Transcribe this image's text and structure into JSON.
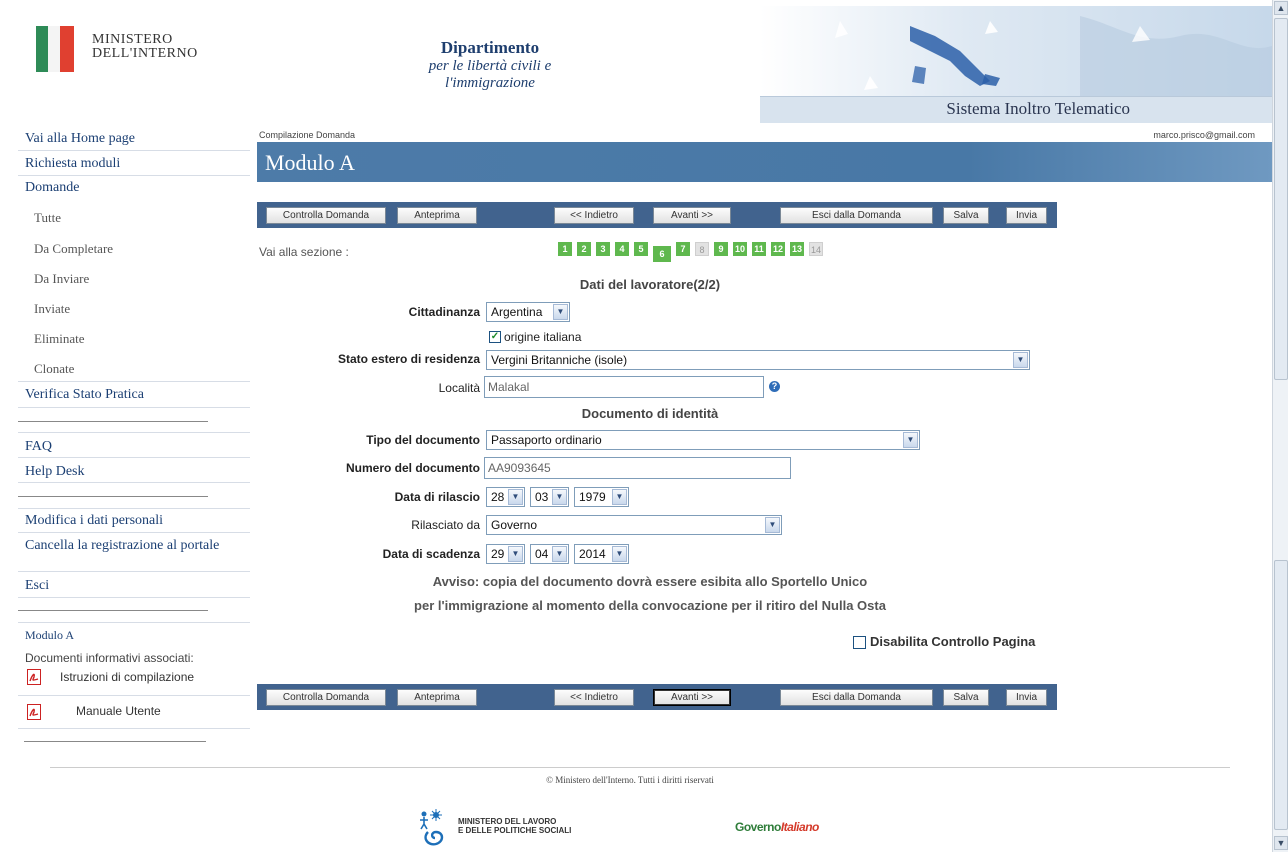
{
  "header": {
    "ministry_line1": "MINISTERO",
    "ministry_line2": "DELL'INTERNO",
    "dept_line1": "Dipartimento",
    "dept_line2": "per le libertà civili e",
    "dept_line3": "l'immigrazione",
    "system_title": "Sistema Inoltro Telematico"
  },
  "nav": {
    "home": "Vai alla Home page",
    "richiesta": "Richiesta moduli",
    "domande": "Domande",
    "tutte": "Tutte",
    "da_completare": "Da Completare",
    "da_inviare": "Da Inviare",
    "inviate": "Inviate",
    "eliminate": "Eliminate",
    "clonate": "Clonate",
    "verifica": "Verifica Stato Pratica",
    "faq": "FAQ",
    "helpdesk": "Help Desk",
    "modifica": "Modifica i dati personali",
    "cancella": "Cancella la registrazione al portale",
    "esci": "Esci",
    "modulo": "Modulo A",
    "documenti": "Documenti informativi associati:",
    "istruzioni": "Istruzioni di compilazione",
    "manuale": "Manuale Utente"
  },
  "main": {
    "breadcrumb": "Compilazione Domanda",
    "user_email": "marco.prisco@gmail.com",
    "title": "Modulo A",
    "vai_sezione": "Vai alla sezione :"
  },
  "toolbar": {
    "controlla": "Controlla Domanda",
    "anteprima": "Anteprima",
    "indietro": "<< Indietro",
    "avanti": "Avanti >>",
    "esci": "Esci dalla Domanda",
    "salva": "Salva",
    "invia": "Invia"
  },
  "sections": [
    {
      "n": "1",
      "state": "done"
    },
    {
      "n": "2",
      "state": "done"
    },
    {
      "n": "3",
      "state": "done"
    },
    {
      "n": "4",
      "state": "done"
    },
    {
      "n": "5",
      "state": "done"
    },
    {
      "n": "6",
      "state": "current"
    },
    {
      "n": "7",
      "state": "done"
    },
    {
      "n": "8",
      "state": "disabled"
    },
    {
      "n": "9",
      "state": "done"
    },
    {
      "n": "10",
      "state": "done"
    },
    {
      "n": "11",
      "state": "done"
    },
    {
      "n": "12",
      "state": "done"
    },
    {
      "n": "13",
      "state": "done"
    },
    {
      "n": "14",
      "state": "disabled"
    }
  ],
  "form": {
    "section1_title": "Dati del lavoratore(2/2)",
    "cittadinanza_label": "Cittadinanza",
    "cittadinanza_value": "Argentina",
    "origine_label": "origine italiana",
    "origine_checked": true,
    "stato_label": "Stato estero di residenza",
    "stato_value": "Vergini Britanniche (isole)",
    "localita_label": "Località",
    "localita_value": "Malakal",
    "section2_title": "Documento di identità",
    "tipo_label": "Tipo del documento",
    "tipo_value": "Passaporto ordinario",
    "numero_label": "Numero del documento",
    "numero_value": "AA9093645",
    "rilascio_label": "Data di rilascio",
    "rilascio_day": "28",
    "rilascio_month": "03",
    "rilascio_year": "1979",
    "rilasciato_label": "Rilasciato da",
    "rilasciato_value": "Governo",
    "scadenza_label": "Data di scadenza",
    "scadenza_day": "29",
    "scadenza_month": "04",
    "scadenza_year": "2014",
    "avviso_line1": "Avviso: copia del documento dovrà essere esibita allo Sportello Unico",
    "avviso_line2": "per l'immigrazione al momento della convocazione per il ritiro del Nulla Osta",
    "disabilita_label": "Disabilita Controllo Pagina"
  },
  "footer": {
    "copyright": "© Ministero dell'Interno. Tutti i diritti riservati",
    "mlps_line1": "MINISTERO DEL LAVORO",
    "mlps_line2": "E DELLE POLITICHE SOCIALI",
    "gov_part1": "Governo",
    "gov_part2": "Italiano"
  },
  "colors": {
    "title_bar": "#4d7ba8",
    "toolbar": "#41638e",
    "section_done": "#5fb84e",
    "nav_link": "#1b3f73"
  }
}
